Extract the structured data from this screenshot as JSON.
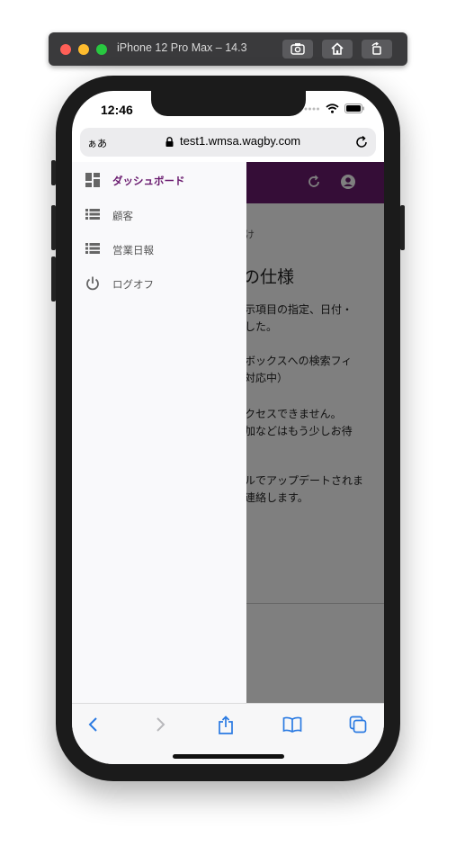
{
  "simulator": {
    "title": "iPhone 12 Pro Max – 14.3",
    "buttons": [
      "screenshot-icon",
      "home-icon",
      "rotate-icon"
    ]
  },
  "status_bar": {
    "time": "12:46"
  },
  "browser": {
    "text_size_label": "ぁあ",
    "url": "test1.wmsa.wagby.com"
  },
  "colors": {
    "brand": "#6a1b6f",
    "link": "#2a7ae2"
  },
  "page": {
    "breadcrumb": "け",
    "heading": "の仕様",
    "paragraphs": [
      [
        "示項目の指定、日付・",
        "した。"
      ],
      [
        "ボックスへの検索フィ",
        "対応中）"
      ],
      [
        "クセスできません。",
        "加などはもう少しお待"
      ],
      [
        "ルでアップデートされま",
        "連絡します。"
      ]
    ]
  },
  "drawer": {
    "items": [
      {
        "label": "ダッシュボード",
        "icon": "dashboard-icon",
        "active": true
      },
      {
        "label": "顧客",
        "icon": "list-icon",
        "active": false
      },
      {
        "label": "営業日報",
        "icon": "list-icon",
        "active": false
      },
      {
        "label": "ログオフ",
        "icon": "power-icon",
        "active": false
      }
    ]
  },
  "toolbar": {
    "items": [
      "back-icon",
      "forward-icon",
      "share-icon",
      "bookmarks-icon",
      "tabs-icon"
    ]
  }
}
